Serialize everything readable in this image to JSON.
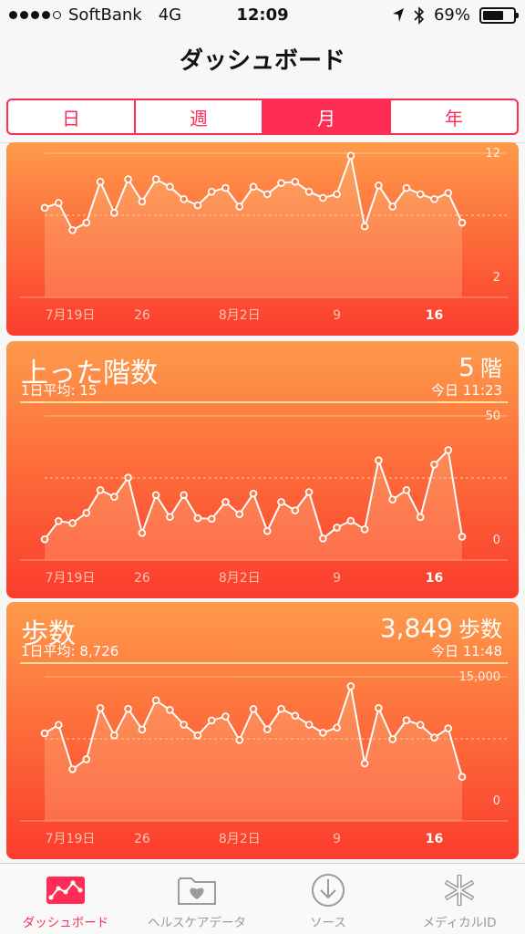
{
  "status_bar": {
    "signal_dots": [
      true,
      true,
      true,
      true,
      false
    ],
    "carrier": "SoftBank",
    "network": "4G",
    "time": "12:09",
    "battery": "69%",
    "battery_level": 0.69,
    "icons": [
      "location-arrow-icon",
      "bluetooth-icon"
    ]
  },
  "nav": {
    "title": "ダッシュボード"
  },
  "segments": [
    {
      "label": "日",
      "active": false
    },
    {
      "label": "週",
      "active": false
    },
    {
      "label": "月",
      "active": true
    },
    {
      "label": "年",
      "active": false
    }
  ],
  "colors": {
    "accent": "#ff2d55",
    "card_top": "#fe9a4b",
    "card_bottom": "#fb3c2d"
  },
  "cards": [
    {
      "title": "",
      "value": "",
      "unit": "",
      "average": "",
      "timestamp": "",
      "chart_data": {
        "type": "line",
        "x_ticks": [
          "7月19日",
          "26",
          "8月2日",
          "9",
          "16"
        ],
        "y_ticks": [
          "12",
          "2"
        ],
        "ylim": [
          2,
          12
        ],
        "values": [
          7.6,
          8.0,
          5.8,
          6.4,
          9.7,
          7.2,
          9.9,
          8.1,
          9.9,
          9.3,
          8.3,
          7.8,
          8.9,
          9.2,
          7.7,
          9.3,
          8.7,
          9.6,
          9.7,
          8.9,
          8.4,
          8.7,
          11.8,
          6.1,
          9.4,
          7.7,
          9.2,
          8.7,
          8.3,
          8.8,
          6.4
        ]
      }
    },
    {
      "title": "上った階数",
      "value": "5",
      "unit": "階",
      "average": "1日平均: 15",
      "timestamp": "今日 11:23",
      "chart_data": {
        "type": "line",
        "x_ticks": [
          "7月19日",
          "26",
          "8月2日",
          "9",
          "16"
        ],
        "y_ticks": [
          "50",
          "0"
        ],
        "ylim": [
          0,
          50
        ],
        "values": [
          0.3,
          7.6,
          6.8,
          10.9,
          20.1,
          17.4,
          25.1,
          2.8,
          18.1,
          9.3,
          18.1,
          8.8,
          8.5,
          15.3,
          10.4,
          18.7,
          3.6,
          15.3,
          11.9,
          19.3,
          0.6,
          5.0,
          7.7,
          4.3,
          32.1,
          16.3,
          20.1,
          9.2,
          30.4,
          36.2,
          1.3
        ]
      }
    },
    {
      "title": "歩数",
      "value": "3,849",
      "unit": "歩数",
      "average": "1日平均: 8,726",
      "timestamp": "今日 11:48",
      "chart_data": {
        "type": "line",
        "x_ticks": [
          "7月19日",
          "26",
          "8月2日",
          "9",
          "16"
        ],
        "y_ticks": [
          "15,000",
          "0"
        ],
        "ylim": [
          0,
          15000
        ],
        "values": [
          8170,
          9180,
          3830,
          5020,
          11220,
          7920,
          11120,
          8620,
          12150,
          10990,
          9210,
          7920,
          9720,
          10200,
          7350,
          11100,
          8650,
          11120,
          10290,
          9210,
          8240,
          8850,
          13850,
          4520,
          11220,
          7450,
          9740,
          9180,
          7660,
          8760,
          2900
        ]
      }
    }
  ],
  "tabbar": [
    {
      "label": "ダッシュボード",
      "icon": "dashboard-chart-icon",
      "active": true
    },
    {
      "label": "ヘルスケアデータ",
      "icon": "health-data-folder-icon",
      "active": false
    },
    {
      "label": "ソース",
      "icon": "sources-download-icon",
      "active": false
    },
    {
      "label": "メディカルID",
      "icon": "medical-id-icon",
      "active": false
    }
  ]
}
